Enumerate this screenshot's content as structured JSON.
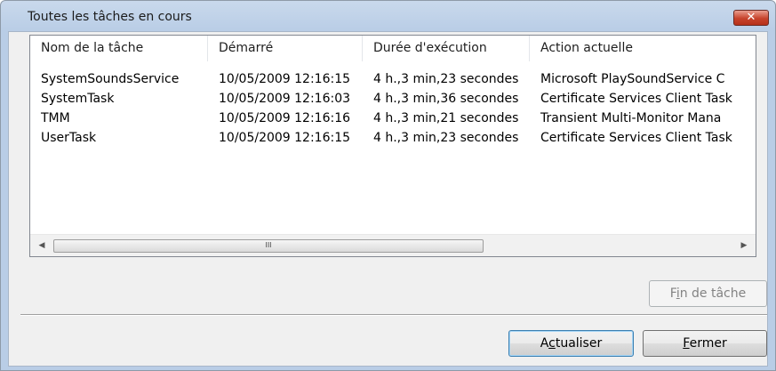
{
  "window": {
    "title": "Toutes les tâches en cours",
    "close_glyph": "✕"
  },
  "table": {
    "columns": [
      "Nom de la tâche",
      "Démarré",
      "Durée d'exécution",
      "Action actuelle"
    ],
    "rows": [
      [
        "SystemSoundsService",
        "10/05/2009 12:16:15",
        "4 h.,3 min,23 secondes",
        "Microsoft PlaySoundService C"
      ],
      [
        "SystemTask",
        "10/05/2009 12:16:03",
        "4 h.,3 min,36 secondes",
        "Certificate Services Client Task"
      ],
      [
        "TMM",
        "10/05/2009 12:16:16",
        "4 h.,3 min,21 secondes",
        "Transient Multi-Monitor Mana"
      ],
      [
        "UserTask",
        "10/05/2009 12:16:15",
        "4 h.,3 min,23 secondes",
        "Certificate Services Client Task"
      ]
    ]
  },
  "scrollbar": {
    "left_arrow": "◀",
    "right_arrow": "▶",
    "grip": "III"
  },
  "buttons": {
    "end_task": {
      "pre": "F",
      "accel": "i",
      "post": "n de tâche"
    },
    "refresh": {
      "pre": "A",
      "accel": "c",
      "post": "tualiser"
    },
    "close": {
      "pre": "",
      "accel": "F",
      "post": "ermer"
    }
  },
  "colors": {
    "title_bar": "#c9d9ec",
    "close_button": "#c7432b",
    "client_bg": "#f0f0f0"
  }
}
